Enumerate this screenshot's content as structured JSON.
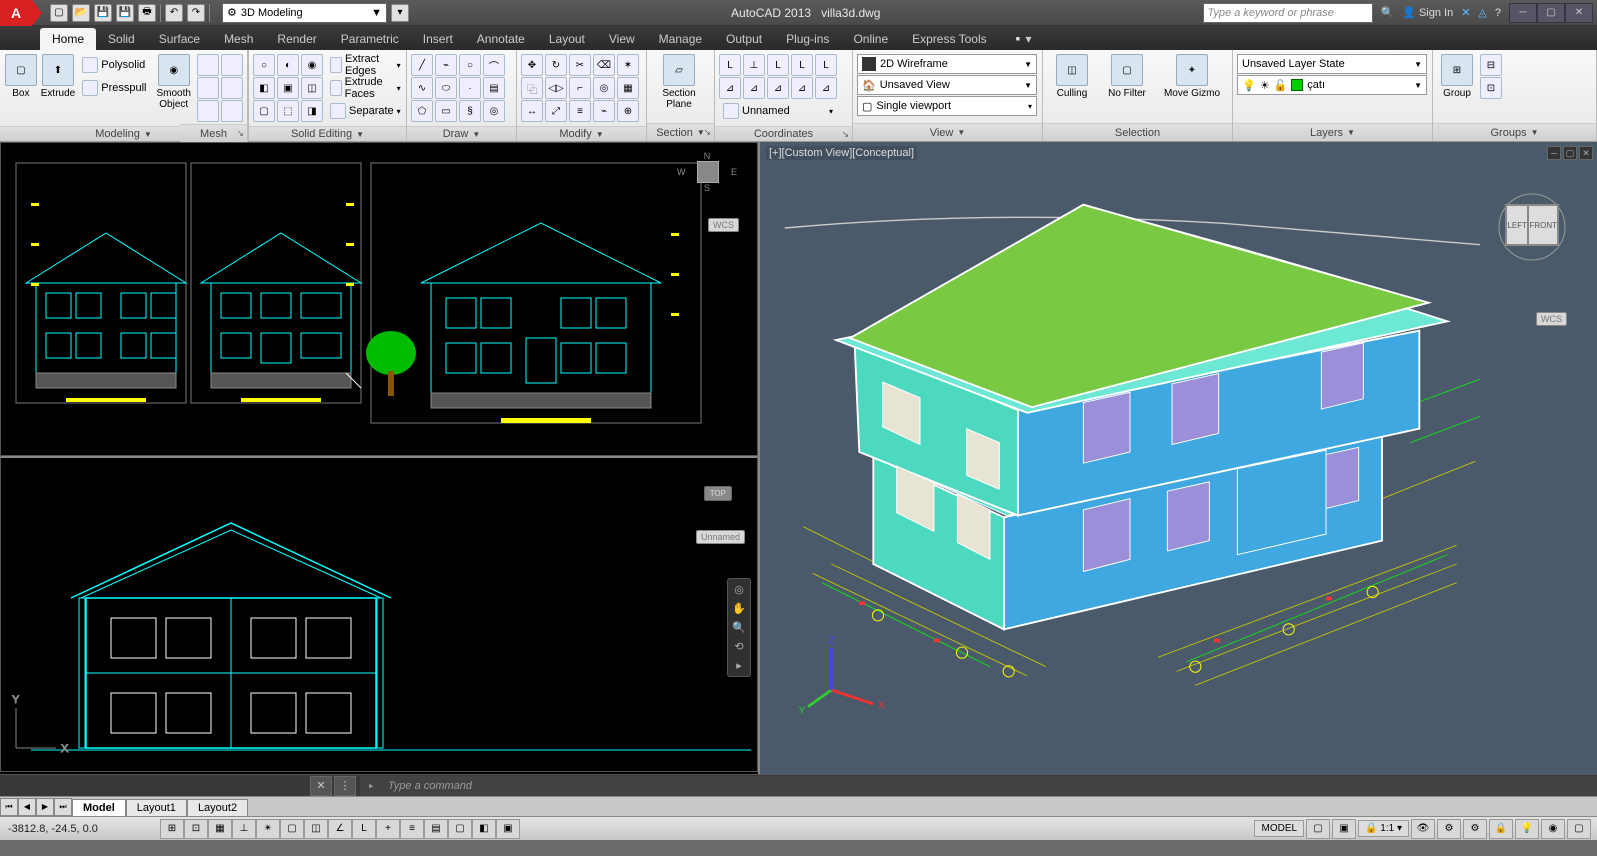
{
  "app": {
    "name": "AutoCAD 2013",
    "file": "villa3d.dwg",
    "logo": "A"
  },
  "qat": {
    "workspace": "3D Modeling"
  },
  "search": {
    "placeholder": "Type a keyword or phrase"
  },
  "signin": "Sign In",
  "tabs": [
    "Home",
    "Solid",
    "Surface",
    "Mesh",
    "Render",
    "Parametric",
    "Insert",
    "Annotate",
    "Layout",
    "View",
    "Manage",
    "Output",
    "Plug-ins",
    "Online",
    "Express Tools"
  ],
  "active_tab": "Home",
  "panels": {
    "modeling": {
      "title": "Modeling",
      "box": "Box",
      "extrude": "Extrude",
      "polysolid": "Polysolid",
      "presspull": "Presspull",
      "smooth": "Smooth Object"
    },
    "mesh": {
      "title": "Mesh"
    },
    "solid_editing": {
      "title": "Solid Editing",
      "extract_edges": "Extract Edges",
      "extrude_faces": "Extrude Faces",
      "separate": "Separate"
    },
    "draw": {
      "title": "Draw"
    },
    "modify": {
      "title": "Modify"
    },
    "section": {
      "title": "Section",
      "section_plane": "Section Plane"
    },
    "coordinates": {
      "title": "Coordinates",
      "unnamed": "Unnamed"
    },
    "view": {
      "title": "View",
      "style": "2D Wireframe",
      "unsaved": "Unsaved View",
      "viewport": "Single viewport"
    },
    "selection": {
      "title": "Selection",
      "culling": "Culling",
      "nofilter": "No Filter",
      "gizmo": "Move Gizmo"
    },
    "layers": {
      "title": "Layers",
      "state": "Unsaved Layer State",
      "current": "çatı"
    },
    "groups": {
      "title": "Groups",
      "group": "Group"
    }
  },
  "viewport3d": {
    "label": "[+][Custom View][Conceptual]",
    "cube_left": "LEFT",
    "cube_front": "FRONT",
    "wcs": "WCS"
  },
  "viewport2d": {
    "wcs": "WCS",
    "unnamed": "Unnamed",
    "compass": {
      "n": "N",
      "s": "S",
      "e": "E",
      "w": "W"
    }
  },
  "cmdline": {
    "placeholder": "Type a command"
  },
  "layout_tabs": [
    "Model",
    "Layout1",
    "Layout2"
  ],
  "active_layout": "Model",
  "status": {
    "coords": "-3812.8, -24.5, 0.0",
    "model": "MODEL",
    "scale": "1:1"
  }
}
